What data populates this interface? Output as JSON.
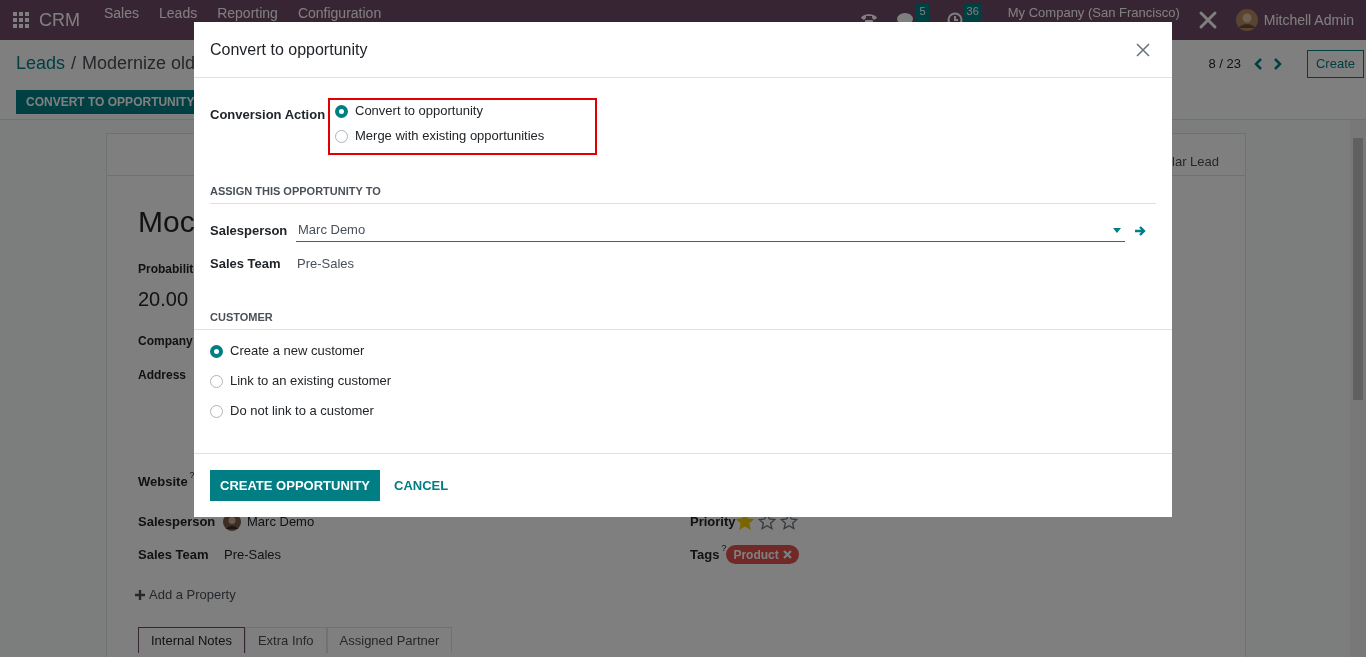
{
  "navbar": {
    "app": "CRM",
    "menu": [
      "Sales",
      "Leads",
      "Reporting",
      "Configuration"
    ],
    "chat_count": "5",
    "activity_count": "36",
    "company": "My Company (San Francisco)",
    "user": "Mitchell Admin"
  },
  "control_panel": {
    "breadcrumb": [
      "Leads",
      "Modernize old"
    ],
    "separator": "/",
    "pager": "8 / 23",
    "create": "Create",
    "convert_button": "CONVERT TO OPPORTUNITY"
  },
  "form": {
    "stage": "lar Lead",
    "title": "Moc",
    "probability_label": "Probabilit",
    "probability": "20.00",
    "labels": [
      "Company",
      "Address"
    ],
    "website": {
      "label": "Website",
      "help": "?"
    },
    "salesperson": {
      "label": "Salesperson",
      "value": "Marc Demo"
    },
    "sales_team": {
      "label": "Sales Team",
      "value": "Pre-Sales"
    },
    "priority": {
      "label": "Priority",
      "stars": 1
    },
    "tags": {
      "label": "Tags",
      "help": "?",
      "items": [
        "Product"
      ]
    },
    "add_property": "Add a Property",
    "tabs": [
      {
        "label": "Internal Notes",
        "selected": true
      },
      {
        "label": "Extra Info",
        "selected": false
      },
      {
        "label": "Assigned Partner",
        "selected": false
      }
    ]
  },
  "dialog": {
    "title": "Convert to opportunity",
    "conversion_label": "Conversion Action",
    "conversion_options": [
      {
        "label": "Convert to opportunity",
        "selected": true
      },
      {
        "label": "Merge with existing opportunities",
        "selected": false
      }
    ],
    "assign_heading": "ASSIGN THIS OPPORTUNITY TO",
    "salesperson": {
      "label": "Salesperson",
      "value": "Marc Demo"
    },
    "sales_team": {
      "label": "Sales Team",
      "value": "Pre-Sales"
    },
    "customer_heading": "CUSTOMER",
    "customer_options": [
      {
        "label": "Create a new customer",
        "selected": true
      },
      {
        "label": "Link to an existing customer",
        "selected": false
      },
      {
        "label": "Do not link to a customer",
        "selected": false
      }
    ],
    "buttons": [
      {
        "label": "CREATE OPPORTUNITY",
        "kind": "primary"
      },
      {
        "label": "CANCEL",
        "kind": "link"
      }
    ]
  }
}
